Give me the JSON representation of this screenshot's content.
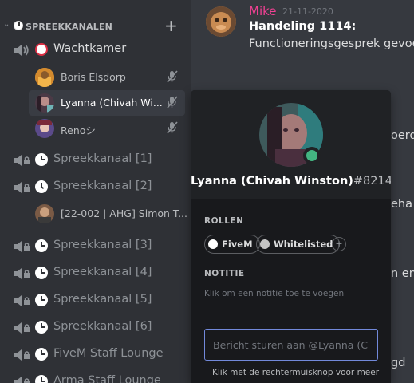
{
  "category": {
    "label": "SPREEKKANALEN"
  },
  "channels": [
    {
      "label": "Wachtkamer",
      "icon": "alarm-clock-icon"
    },
    {
      "label": "Spreekkanaal [1]"
    },
    {
      "label": "Spreekkanaal [2]"
    },
    {
      "label": "Spreekkanaal [3]"
    },
    {
      "label": "Spreekkanaal [4]"
    },
    {
      "label": "Spreekkanaal [5]"
    },
    {
      "label": "Spreekkanaal [6]"
    },
    {
      "label": "FiveM Staff Lounge"
    },
    {
      "label": "Arma Staff Lounge"
    }
  ],
  "voice_users": [
    {
      "name": "Boris Elsdorp"
    },
    {
      "name": "Lyanna (Chivah Wi..."
    },
    {
      "name": "Renoシ"
    },
    {
      "name": "[22-002 | AHG] Simon T..."
    }
  ],
  "message": {
    "author": "Mike",
    "timestamp": "21-11-2020",
    "title": "Handeling 1114:",
    "body": "Functioneringsgesprek gevoerd"
  },
  "chat_fragments": [
    "oerd",
    "eha",
    "n en",
    "gd"
  ],
  "popout": {
    "username": "Lyanna (Chivah Winston)",
    "discriminator": "#8214",
    "roles_label": "ROLLEN",
    "roles": [
      {
        "name": "FiveM",
        "color": "#ffffff"
      },
      {
        "name": "Whitelisted",
        "color": "#c4c4c4"
      }
    ],
    "add_role": "+",
    "note_label": "NOTITIE",
    "note_placeholder": "Klik om een notitie toe te voegen",
    "message_placeholder": "Bericht sturen aan @Lyanna (Chivah Winston)",
    "footer": "Klik met de rechtermuisknop voor meer"
  },
  "colors": {
    "sidebar_bg": "#2f3136",
    "chat_bg": "#36393f",
    "popout_bg": "#18191c",
    "author": "#f04193",
    "online": "#43b581",
    "input_focus": "#7289da"
  }
}
